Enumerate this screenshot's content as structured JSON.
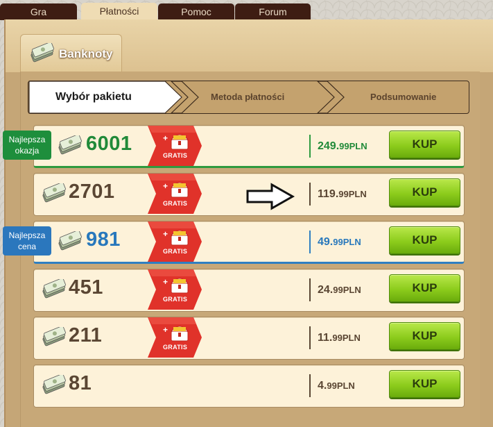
{
  "top_tabs": [
    {
      "label": "Gra",
      "active": false
    },
    {
      "label": "Płatności",
      "active": true
    },
    {
      "label": "Pomoc",
      "active": false
    },
    {
      "label": "Forum",
      "active": false
    }
  ],
  "section": {
    "title": "Banknoty",
    "icon": "banknotes-icon"
  },
  "steps": [
    {
      "label": "Wybór pakietu",
      "active": true
    },
    {
      "label": "Metoda płatności",
      "active": false
    },
    {
      "label": "Podsumowanie",
      "active": false
    }
  ],
  "badges": {
    "best_deal": "Najlepsza okazja",
    "best_deal_line1": "Najlepsza",
    "best_deal_line2": "okazja",
    "best_price_line1": "Najlepsza",
    "best_price_line2": "cena"
  },
  "gratis": {
    "plus": "+",
    "label": "GRATIS",
    "icon": "treasure-chest-icon"
  },
  "packages": [
    {
      "amount": "6001",
      "price_int": "249.",
      "price_dec": "99",
      "currency": "PLN",
      "buy": "KUP",
      "gratis": true,
      "highlight": "best-deal"
    },
    {
      "amount": "2701",
      "price_int": "119.",
      "price_dec": "99",
      "currency": "PLN",
      "buy": "KUP",
      "gratis": true,
      "highlight": "none"
    },
    {
      "amount": "981",
      "price_int": "49.",
      "price_dec": "99",
      "currency": "PLN",
      "buy": "KUP",
      "gratis": true,
      "highlight": "best-price"
    },
    {
      "amount": "451",
      "price_int": "24.",
      "price_dec": "99",
      "currency": "PLN",
      "buy": "KUP",
      "gratis": true,
      "highlight": "none"
    },
    {
      "amount": "211",
      "price_int": "11.",
      "price_dec": "99",
      "currency": "PLN",
      "buy": "KUP",
      "gratis": true,
      "highlight": "none"
    },
    {
      "amount": "81",
      "price_int": "4.",
      "price_dec": "99",
      "currency": "PLN",
      "buy": "KUP",
      "gratis": false,
      "highlight": "none"
    }
  ],
  "colors": {
    "best_deal": "#218a39",
    "best_price": "#2878bc",
    "buy_button": "#8ccc1c",
    "gratis_ribbon": "#e0322a",
    "tab_dark": "#3e1d13"
  }
}
